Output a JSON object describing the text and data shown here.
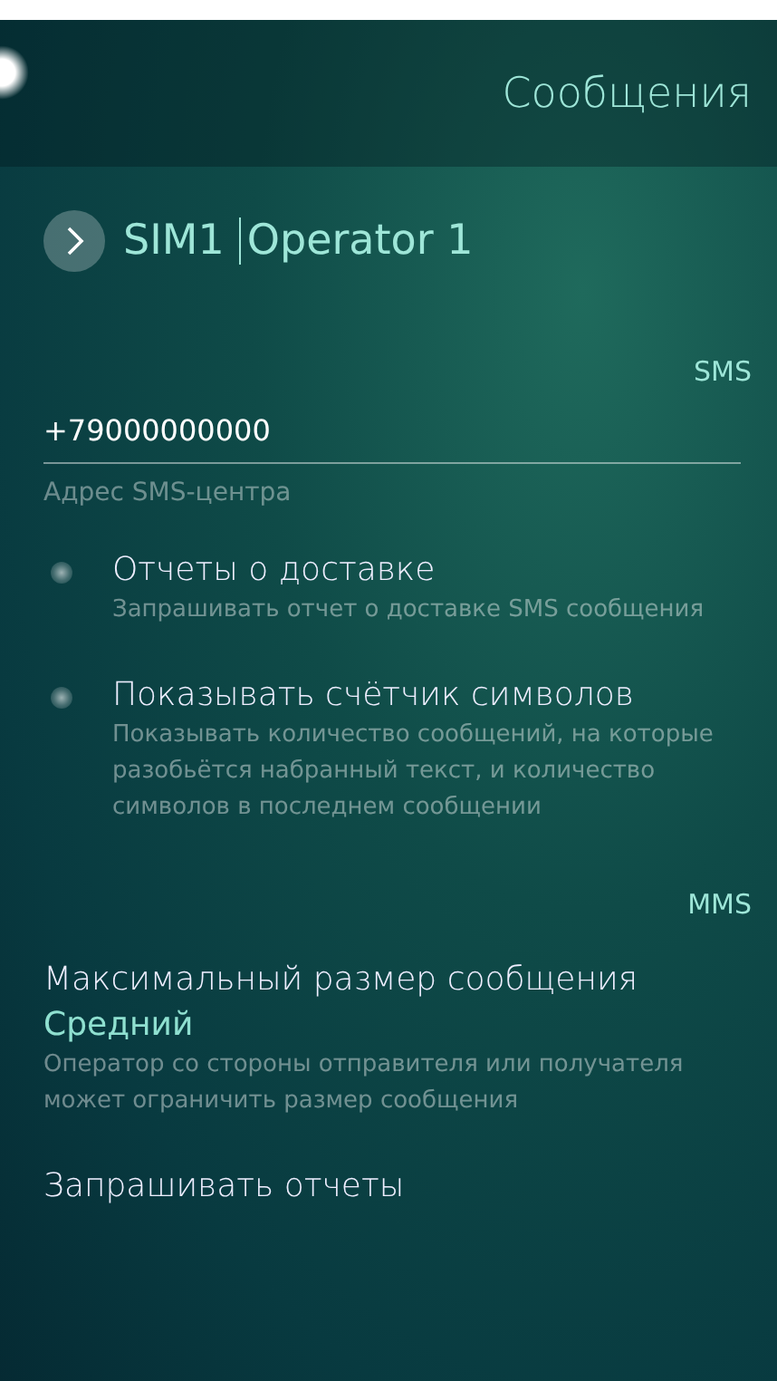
{
  "header": {
    "title": "Сообщения"
  },
  "sim": {
    "label": "SIM1",
    "operator": "Operator 1",
    "expanded": false
  },
  "sections": [
    {
      "title": "SMS",
      "items": [
        {
          "kind": "field",
          "value": "+79000000000",
          "label": "Адрес SMS-центра"
        },
        {
          "kind": "switch",
          "title": "Отчеты о доставке",
          "description": "Запрашивать отчет о доставке SMS сообщения",
          "checked": false
        },
        {
          "kind": "switch",
          "title": "Показывать счётчик символов",
          "description": "Показывать количество сообщений, на которые разобьётся набранный текст, и количество символов в последнем сообщении",
          "checked": false
        }
      ]
    },
    {
      "title": "MMS",
      "items": [
        {
          "kind": "combo",
          "title": "Максимальный размер сообщения",
          "value": "Средний",
          "description": "Оператор со стороны отправителя или получателя может ограничить размер сообщения"
        },
        {
          "kind": "combo",
          "title": "Запрашивать отчеты"
        }
      ]
    }
  ]
}
